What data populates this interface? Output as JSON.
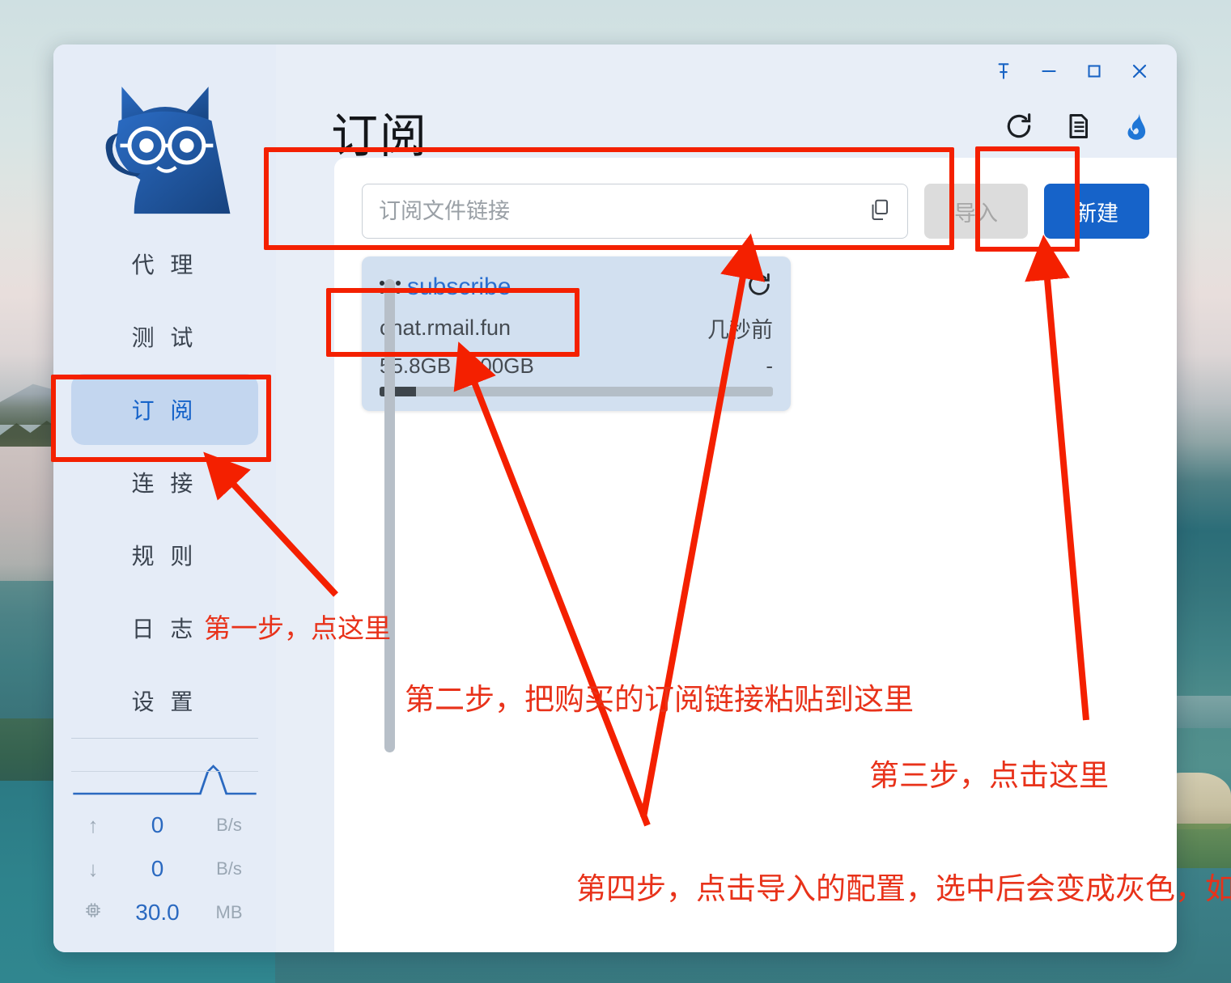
{
  "window": {
    "controls": [
      {
        "name": "pin",
        "label": "固定"
      },
      {
        "name": "minimize",
        "label": "最小化"
      },
      {
        "name": "maximize",
        "label": "最大化"
      },
      {
        "name": "close",
        "label": "关闭"
      }
    ]
  },
  "sidebar": {
    "logo": "cat-logo",
    "items": [
      {
        "label": "代 理",
        "active": false
      },
      {
        "label": "测 试",
        "active": false
      },
      {
        "label": "订 阅",
        "active": true
      },
      {
        "label": "连 接",
        "active": false
      },
      {
        "label": "规 则",
        "active": false
      },
      {
        "label": "日 志",
        "active": false
      },
      {
        "label": "设 置",
        "active": false
      }
    ],
    "stats": [
      {
        "icon": "arrow-up-icon",
        "value": "0",
        "unit": "B/s"
      },
      {
        "icon": "arrow-down-icon",
        "value": "0",
        "unit": "B/s"
      },
      {
        "icon": "memory-chip-icon",
        "value": "30.0",
        "unit": "MB"
      }
    ]
  },
  "main": {
    "title": "订阅",
    "toolbar_icons": [
      {
        "name": "refresh-icon"
      },
      {
        "name": "document-icon"
      },
      {
        "name": "flame-icon"
      }
    ],
    "search": {
      "placeholder": "订阅文件链接",
      "value": "",
      "copy_icon": "copy-icon"
    },
    "import_button": "导入",
    "new_button": "新建",
    "subscriptions": [
      {
        "name": "subscribe",
        "domain": "chat.rmail.fun",
        "updated": "几秒前",
        "usage": "55.8GB / 600GB",
        "expiry": "-",
        "progress_percent": 9.3,
        "refresh_icon": "refresh-icon",
        "drag_handle_icon": "drag-dots-icon"
      }
    ]
  },
  "annotations": [
    {
      "id": "step1",
      "text": "第一步，点这里"
    },
    {
      "id": "step2",
      "text": "第二步，把购买的订阅链接粘贴到这里"
    },
    {
      "id": "step3",
      "text": "第三步，点击这里"
    },
    {
      "id": "step4",
      "text": "第四步，点击导入的配置，选中后会变成灰色，如图"
    }
  ],
  "colors": {
    "accent": "#1663c9",
    "annotation_red": "#e8321a",
    "sidebar_bg": "#e5ecf7",
    "active_item_bg": "#c3d6ef",
    "card_bg": "#d2e0f0"
  }
}
